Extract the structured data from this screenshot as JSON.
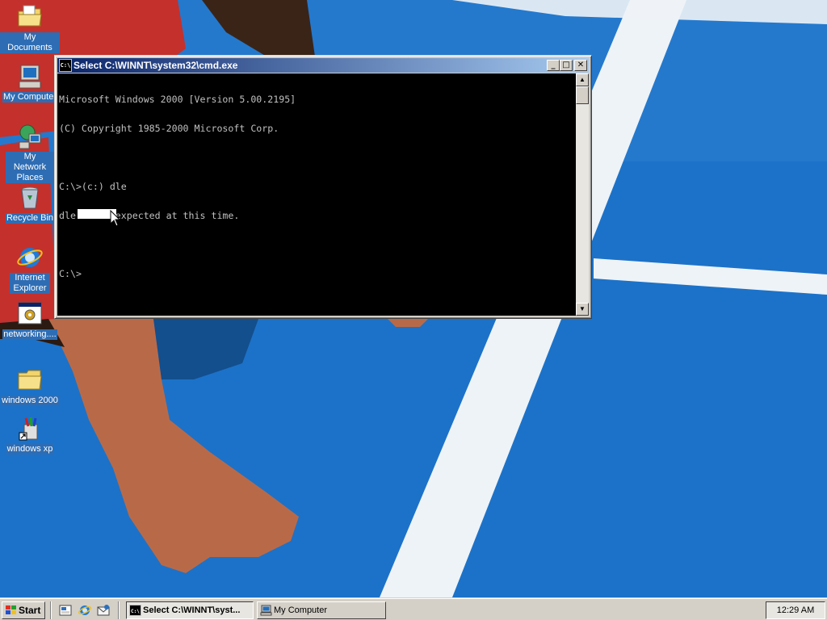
{
  "desktop": {
    "icons": [
      {
        "label": "My Documents",
        "icon": "folder-documents-icon"
      },
      {
        "label": "My Computer",
        "icon": "computer-icon"
      },
      {
        "label": "My Network Places",
        "icon": "network-places-icon"
      },
      {
        "label": "Recycle Bin",
        "icon": "recycle-bin-icon"
      },
      {
        "label": "Internet Explorer",
        "icon": "internet-explorer-icon"
      },
      {
        "label": "networking....",
        "icon": "program-settings-icon"
      },
      {
        "label": "windows 2000",
        "icon": "folder-icon"
      },
      {
        "label": "windows xp",
        "icon": "setup-shortcut-icon"
      }
    ]
  },
  "cmd_window": {
    "title": "Select C:\\WINNT\\system32\\cmd.exe",
    "sys_icon_text": "C:\\",
    "minimize_glyph": "_",
    "maximize_glyph": "□",
    "close_glyph": "✕",
    "lines": [
      "Microsoft Windows 2000 [Version 5.00.2195]",
      "(C) Copyright 1985-2000 Microsoft Corp.",
      "",
      "C:\\>(c:) dle",
      "dle was unexpected at this time.",
      "",
      "C:\\>"
    ],
    "colors": {
      "console_bg": "#000000",
      "console_fg": "#c0c0c0",
      "title_start": "#0a246a",
      "title_end": "#a6caf0"
    }
  },
  "taskbar": {
    "start_label": "Start",
    "quick_launch": [
      "show-desktop-icon",
      "internet-explorer-icon",
      "outlook-express-icon"
    ],
    "tasks": [
      {
        "label": "Select C:\\WINNT\\syst...",
        "icon": "cmd-icon",
        "active": true
      },
      {
        "label": "My Computer",
        "icon": "computer-icon",
        "active": false
      }
    ],
    "clock": "12:29 AM"
  }
}
